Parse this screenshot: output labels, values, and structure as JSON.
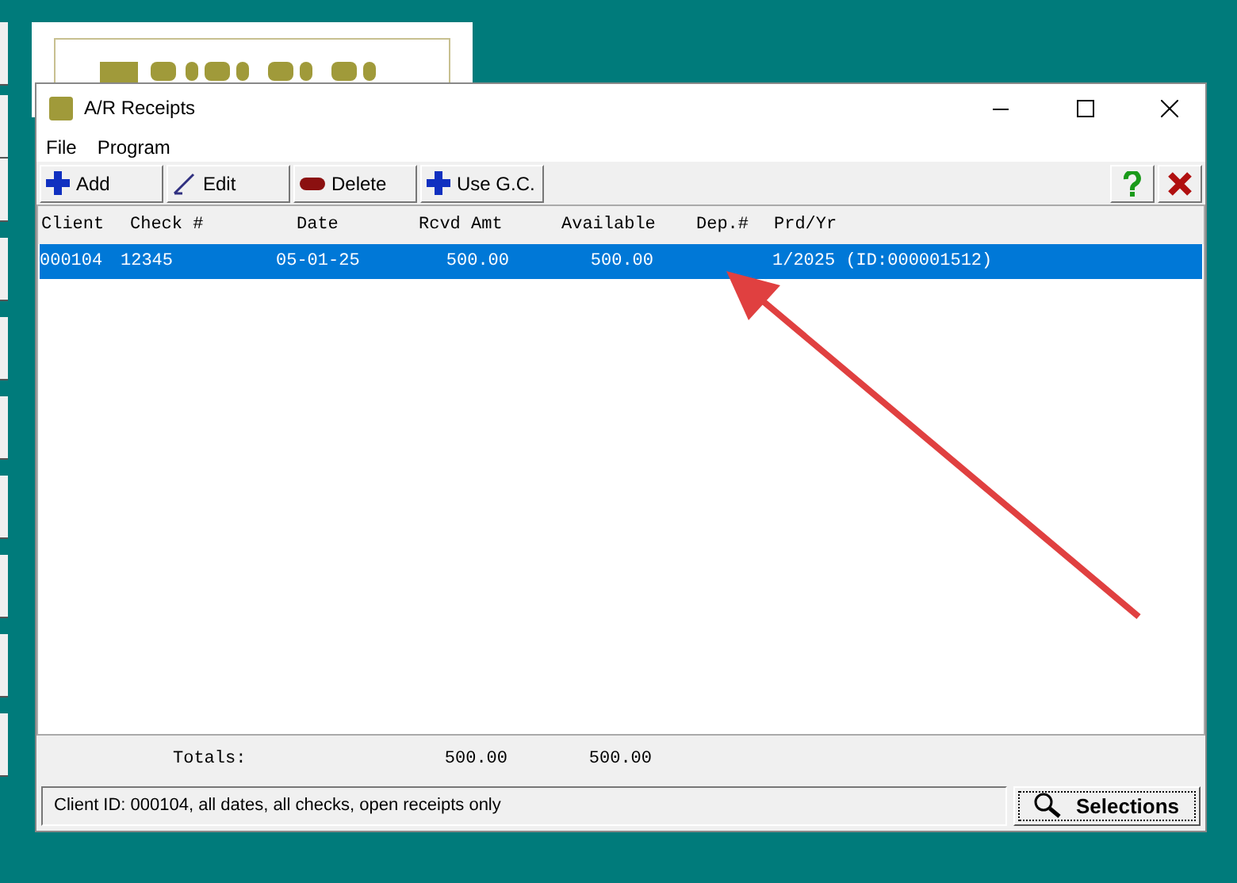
{
  "window": {
    "title": "A/R Receipts"
  },
  "menu": [
    "File",
    "Program"
  ],
  "toolbar": [
    {
      "label": "Add",
      "kind": "plus"
    },
    {
      "label": "Edit",
      "kind": "pen"
    },
    {
      "label": "Delete",
      "kind": "minus"
    },
    {
      "label": "Use G.C.",
      "kind": "plus"
    }
  ],
  "table": {
    "columns": [
      "Client",
      "Check #",
      "Date",
      "Rcvd Amt",
      "Available",
      "Dep.#",
      "Prd/Yr"
    ],
    "rows": [
      {
        "cells": [
          "000104",
          "12345",
          "05-01-25",
          "500.00",
          "500.00",
          "",
          "1/2025 (ID:000001512)"
        ],
        "selected": true
      }
    ]
  },
  "totals": {
    "label": "Totals:",
    "values": [
      "500.00",
      "500.00"
    ]
  },
  "status_bar": {
    "text": "Client ID: 000104, all dates, all checks, open receipts only",
    "button": "Selections"
  }
}
